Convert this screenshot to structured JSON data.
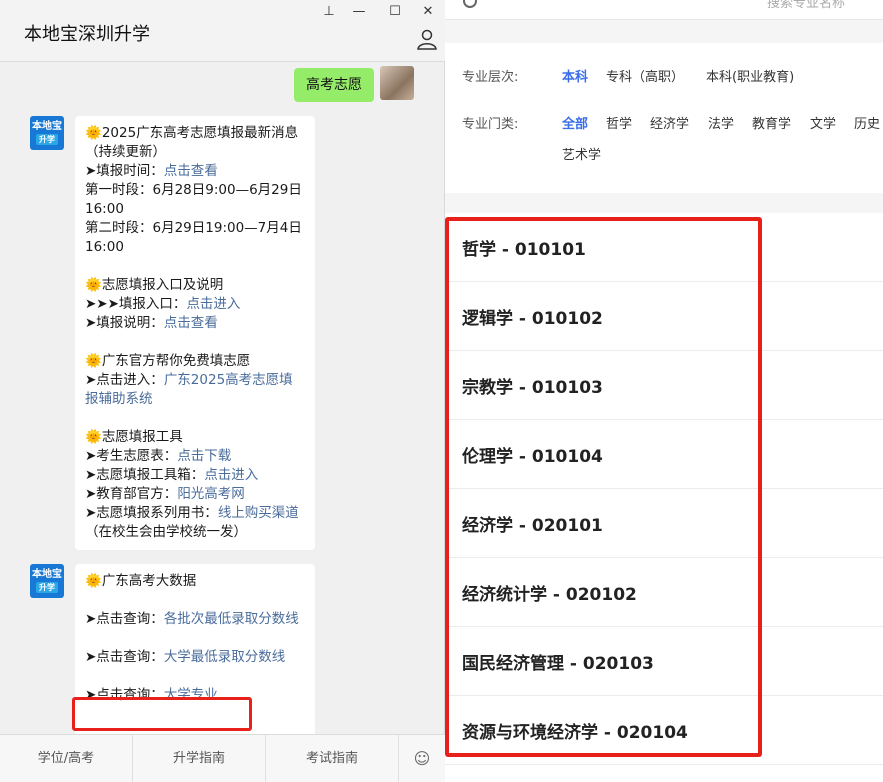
{
  "chat": {
    "title": "本地宝深圳升学",
    "window_controls": {
      "pin": "⊥",
      "min": "—",
      "max": "☐",
      "close": "✕"
    },
    "my_message": "高考志愿",
    "bot_avatar": {
      "top": "本地宝",
      "tag": "升学"
    },
    "message1": {
      "lines": [
        {
          "sun": "🌞",
          "text": "2025广东高考志愿填报最新消息（持续更新）",
          "link": ""
        },
        {
          "prefix": "➤填报时间：",
          "link": "点击查看"
        },
        {
          "text": "第一时段：6月28日9:00—6月29日16:00"
        },
        {
          "text": "第二时段：6月29日19:00—7月4日16:00"
        },
        {
          "text": ""
        },
        {
          "sun": "🌞",
          "text": "志愿填报入口及说明"
        },
        {
          "prefix": "➤➤➤填报入口：",
          "link": "点击进入"
        },
        {
          "prefix": "➤填报说明：",
          "link": "点击查看"
        },
        {
          "text": ""
        },
        {
          "sun": "🌞",
          "text": "广东官方帮你免费填志愿"
        },
        {
          "prefix": "➤点击进入：",
          "link": "广东2025高考志愿填报辅助系统"
        },
        {
          "text": ""
        },
        {
          "sun": "🌞",
          "text": "志愿填报工具"
        },
        {
          "prefix": "➤考生志愿表：",
          "link": "点击下载"
        },
        {
          "prefix": "➤志愿填报工具箱：",
          "link": "点击进入"
        },
        {
          "prefix": "➤教育部官方：",
          "link": "阳光高考网"
        },
        {
          "prefix": "➤志愿填报系列用书：",
          "link": "线上购买渠道",
          "suffix": "（在校生会由学校统一发）"
        }
      ]
    },
    "message2": {
      "title": "广东高考大数据",
      "sun": "🌞",
      "q1_prefix": "➤点击查询：",
      "q1_link": "各批次最低录取分数线",
      "q2_prefix": "➤点击查询：",
      "q2_link": "大学最低录取分数线",
      "q3_prefix": "➤点击查询：",
      "q3_link": "大学专业"
    },
    "footer": {
      "tab1": "学位/高考",
      "tab2": "升学指南",
      "tab3": "考试指南",
      "kbd": "☺"
    }
  },
  "page": {
    "search_placeholder": "搜索专业名称",
    "level_label": "专业层次:",
    "levels": [
      "本科",
      "专科（高职）",
      "本科(职业教育)"
    ],
    "category_label": "专业门类:",
    "categories": [
      "全部",
      "哲学",
      "经济学",
      "法学",
      "教育学",
      "文学",
      "历史",
      "艺术学"
    ],
    "majors": [
      "哲学 - 010101",
      "逻辑学 - 010102",
      "宗教学 - 010103",
      "伦理学 - 010104",
      "经济学 - 020101",
      "经济统计学 - 020102",
      "国民经济管理 - 020103",
      "资源与环境经济学 - 020104"
    ]
  },
  "colors": {
    "accent": "#3a6ee8",
    "highlight": "#e8201a",
    "bubble_me": "#95ec69",
    "link": "#4a6c9b"
  }
}
